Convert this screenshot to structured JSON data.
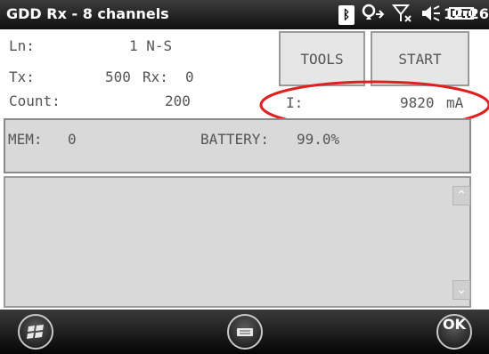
{
  "title_bar": {
    "app_title": "GDD Rx - 8 channels",
    "icons": [
      "bluetooth-icon",
      "network-icon",
      "signal-off-icon",
      "volume-icon",
      "battery-icon"
    ],
    "time": "12:26"
  },
  "fields": {
    "ln_label": "Ln:",
    "ln_value": "1 N-S",
    "tx_label": "Tx:",
    "tx_value": "500",
    "rx_label": "Rx:",
    "rx_value": "0",
    "count_label": "Count:",
    "count_value": "200",
    "current_label": "I:",
    "current_value": "9820",
    "current_unit": "mA"
  },
  "buttons": {
    "tools": "TOOLS",
    "start": "START"
  },
  "status_panel": {
    "mem_label": "MEM:",
    "mem_value": "0",
    "battery_label": "BATTERY:",
    "battery_value": "99.0%"
  },
  "bottom_bar": {
    "ok_label": "OK",
    "start_icon": "windows-start-icon",
    "keyboard_icon": "keyboard-icon"
  },
  "colors": {
    "titlebar": "#1e1e1e",
    "panel_bg": "#d9d9d9",
    "annotation": "#e02020"
  }
}
